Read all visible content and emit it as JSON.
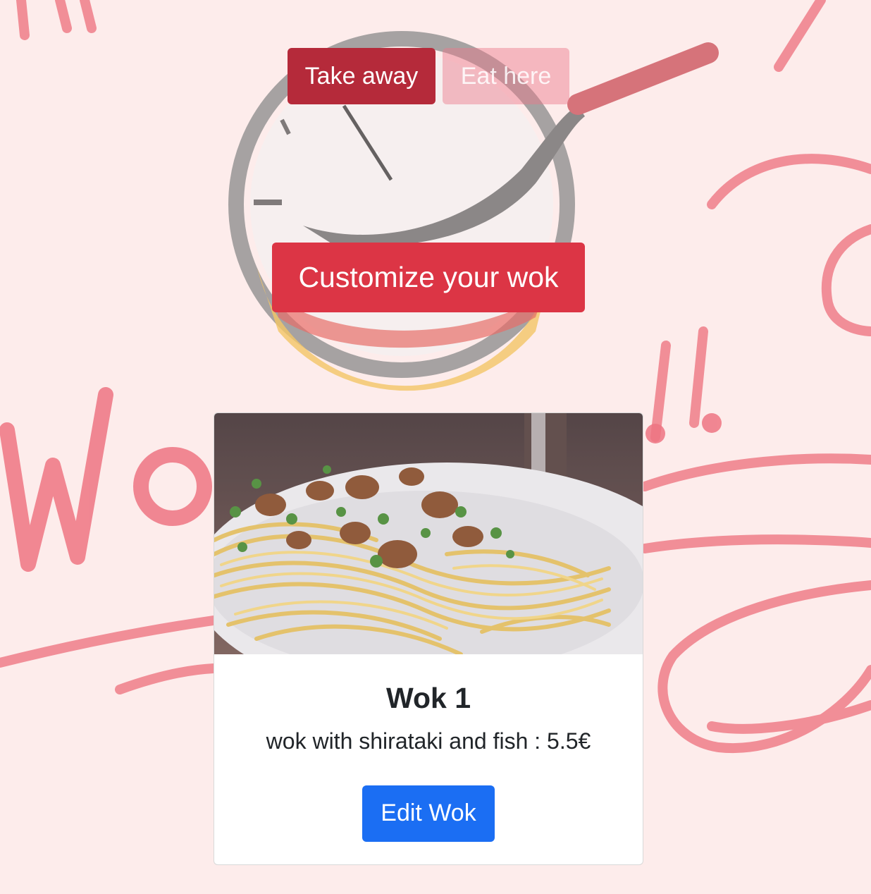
{
  "order_mode": {
    "take_away_label": "Take away",
    "eat_here_label": "Eat here",
    "selected": "Take away"
  },
  "customize_label": "Customize your wok",
  "wok_card": {
    "title": "Wok 1",
    "description": "wok with shirataki and fish : 5.5€",
    "edit_label": "Edit Wok",
    "image": "noodle-dish-photo"
  },
  "colors": {
    "background": "#fdeceb",
    "take_away": "#b52a3a",
    "eat_here": "#ea788a",
    "customize": "#dc3545",
    "edit": "#1b6ef3",
    "doodle": "#ec6f7c"
  }
}
